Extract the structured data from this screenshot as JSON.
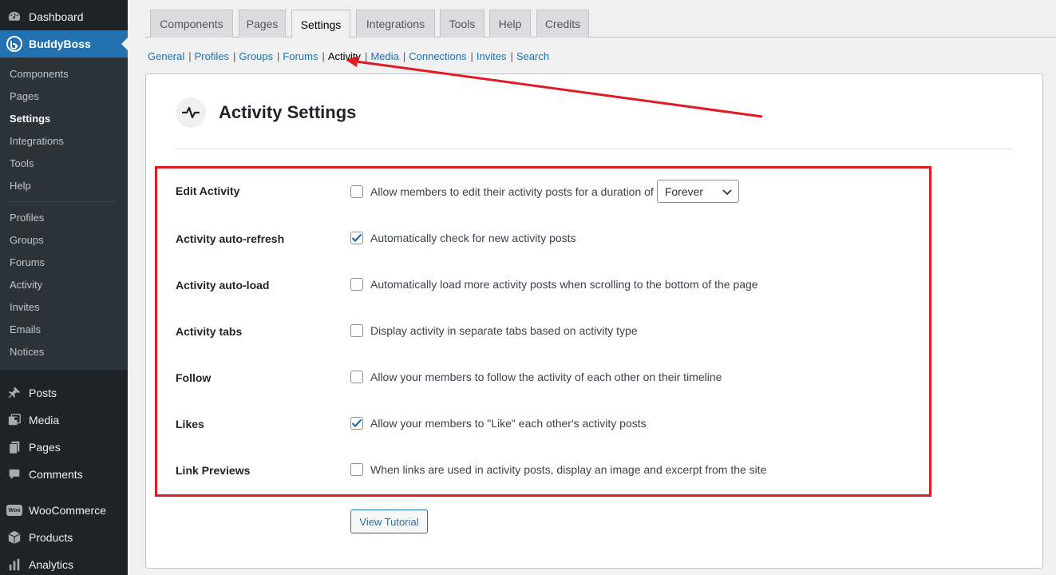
{
  "sidebar": {
    "dashboard": "Dashboard",
    "buddyboss": "BuddyBoss",
    "submenu": [
      "Components",
      "Pages",
      "Settings",
      "Integrations",
      "Tools",
      "Help",
      "Profiles",
      "Groups",
      "Forums",
      "Activity",
      "Invites",
      "Emails",
      "Notices"
    ],
    "active_submenu": "Settings",
    "posts": "Posts",
    "media": "Media",
    "pages": "Pages",
    "comments": "Comments",
    "woocommerce": "WooCommerce",
    "woo_badge": "Woo",
    "products": "Products",
    "analytics": "Analytics"
  },
  "tabs": [
    "Components",
    "Pages",
    "Settings",
    "Integrations",
    "Tools",
    "Help",
    "Credits"
  ],
  "active_tab": "Settings",
  "subnav": [
    "General",
    "Profiles",
    "Groups",
    "Forums",
    "Activity",
    "Media",
    "Connections",
    "Invites",
    "Search"
  ],
  "subnav_current": "Activity",
  "card": {
    "title": "Activity Settings",
    "rows": [
      {
        "label": "Edit Activity",
        "text": "Allow members to edit their activity posts for a duration of",
        "checked": false,
        "select_value": "Forever"
      },
      {
        "label": "Activity auto-refresh",
        "text": "Automatically check for new activity posts",
        "checked": true
      },
      {
        "label": "Activity auto-load",
        "text": "Automatically load more activity posts when scrolling to the bottom of the page",
        "checked": false
      },
      {
        "label": "Activity tabs",
        "text": "Display activity in separate tabs based on activity type",
        "checked": false
      },
      {
        "label": "Follow",
        "text": "Allow your members to follow the activity of each other on their timeline",
        "checked": false
      },
      {
        "label": "Likes",
        "text": "Allow your members to \"Like\" each other's activity posts",
        "checked": true
      },
      {
        "label": "Link Previews",
        "text": "When links are used in activity posts, display an image and excerpt from the site",
        "checked": false
      }
    ],
    "tutorial_button": "View Tutorial"
  },
  "colors": {
    "accent": "#2271b1",
    "sidebar_bg": "#1d2327",
    "annotation": "#e01b24",
    "checkbox_check": "#2271b1"
  }
}
